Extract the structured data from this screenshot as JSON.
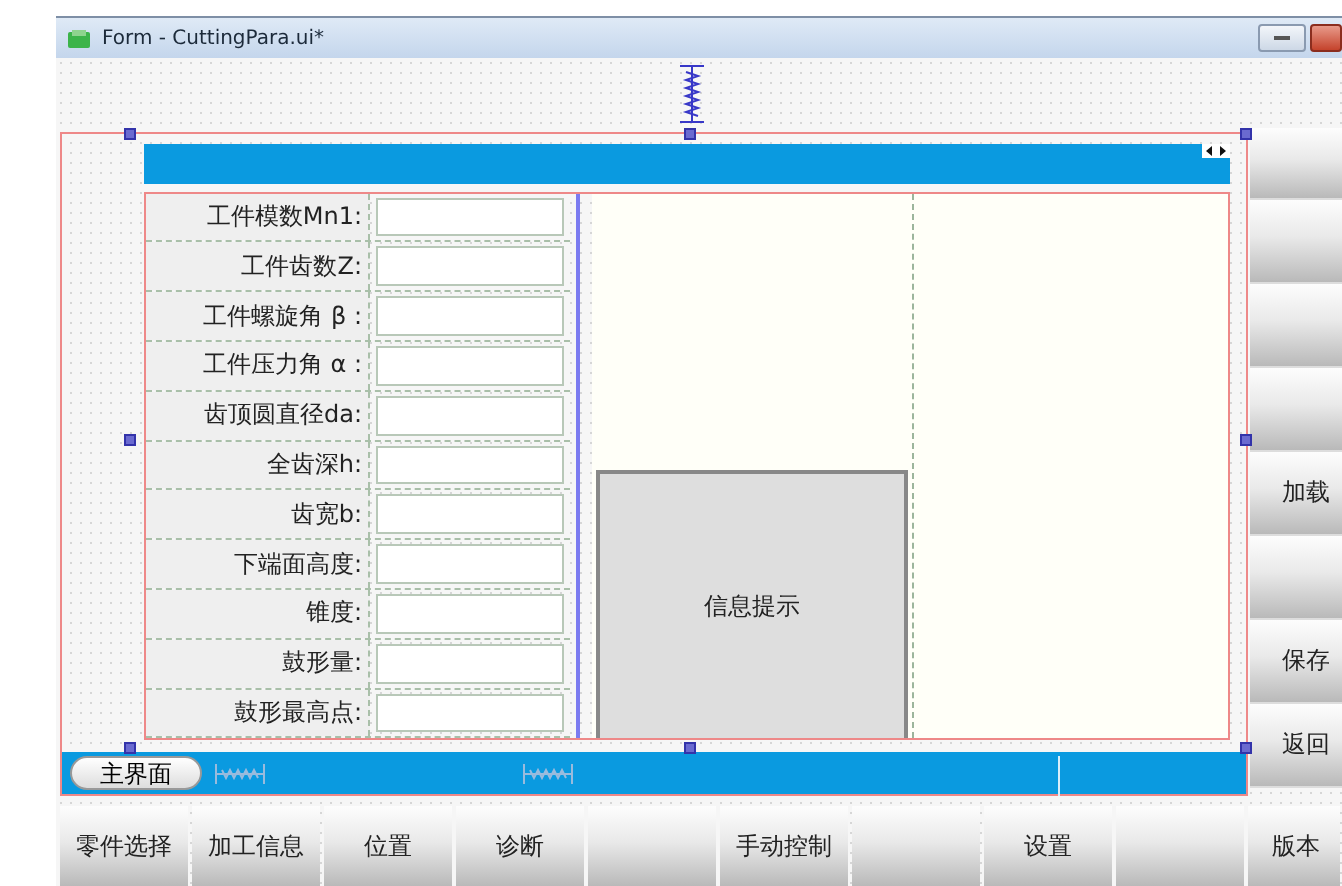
{
  "window": {
    "title": "Form - CuttingPara.ui*"
  },
  "fields": [
    {
      "label": "工件模数Mn1:"
    },
    {
      "label": "工件齿数Z:"
    },
    {
      "label": "工件螺旋角 β :"
    },
    {
      "label": "工件压力角 α :"
    },
    {
      "label": "齿顶圆直径da:"
    },
    {
      "label": "全齿深h:"
    },
    {
      "label": "齿宽b:"
    },
    {
      "label": "下端面高度:"
    },
    {
      "label": "锥度:"
    },
    {
      "label": "鼓形量:"
    },
    {
      "label": "鼓形最高点:"
    }
  ],
  "info_panel": {
    "label": "信息提示"
  },
  "side_buttons": [
    {
      "kind": "blank"
    },
    {
      "kind": "blank"
    },
    {
      "kind": "blank"
    },
    {
      "kind": "blank"
    },
    {
      "kind": "text",
      "label": "加载"
    },
    {
      "kind": "blank"
    },
    {
      "kind": "text",
      "label": "保存"
    },
    {
      "kind": "text",
      "label": "返回"
    }
  ],
  "home_tab": {
    "label": "主界面"
  },
  "nav_buttons": [
    {
      "kind": "text",
      "label": "零件选择"
    },
    {
      "kind": "text",
      "label": "加工信息"
    },
    {
      "kind": "text",
      "label": "位置"
    },
    {
      "kind": "text",
      "label": "诊断"
    },
    {
      "kind": "blank"
    },
    {
      "kind": "text",
      "label": "手动控制"
    },
    {
      "kind": "blank"
    },
    {
      "kind": "text",
      "label": "设置"
    },
    {
      "kind": "blank"
    },
    {
      "kind": "text",
      "label": "版本"
    }
  ]
}
